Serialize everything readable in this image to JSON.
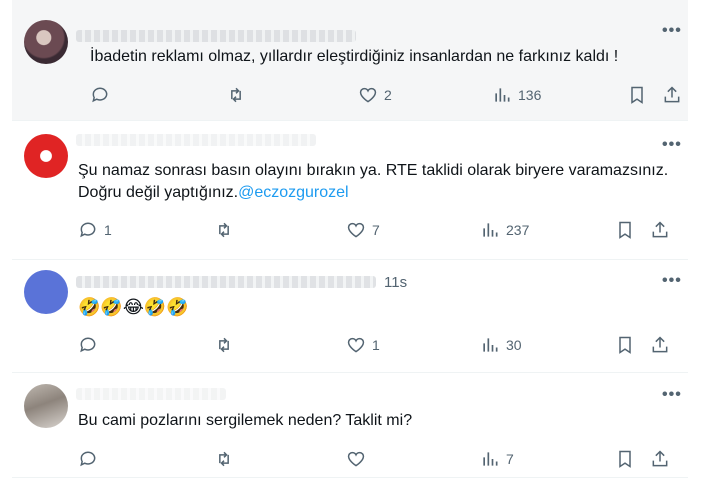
{
  "tweets": [
    {
      "text": "İbadetin reklamı olmaz, yıllardır eleştirdiğiniz insanlardan ne farkınız kaldı !",
      "replies": "",
      "likes": "2",
      "views": "136"
    },
    {
      "text": "Şu namaz sonrası basın olayını bırakın ya. RTE taklidi olarak biryere varamazsınız. Doğru değil yaptığınız.",
      "mention": "@eczozgurozel",
      "replies": "1",
      "likes": "7",
      "views": "237"
    },
    {
      "time": "11s",
      "text": "🤣🤣😂🤣🤣",
      "replies": "",
      "likes": "1",
      "views": "30"
    },
    {
      "text": "Bu cami pozlarını sergilemek neden? Taklit mi?",
      "replies": "",
      "likes": "",
      "views": "7"
    }
  ],
  "more_label": "•••",
  "colors": {
    "accent": "#1d9bf0",
    "muted": "#536471",
    "text": "#0f1419"
  }
}
